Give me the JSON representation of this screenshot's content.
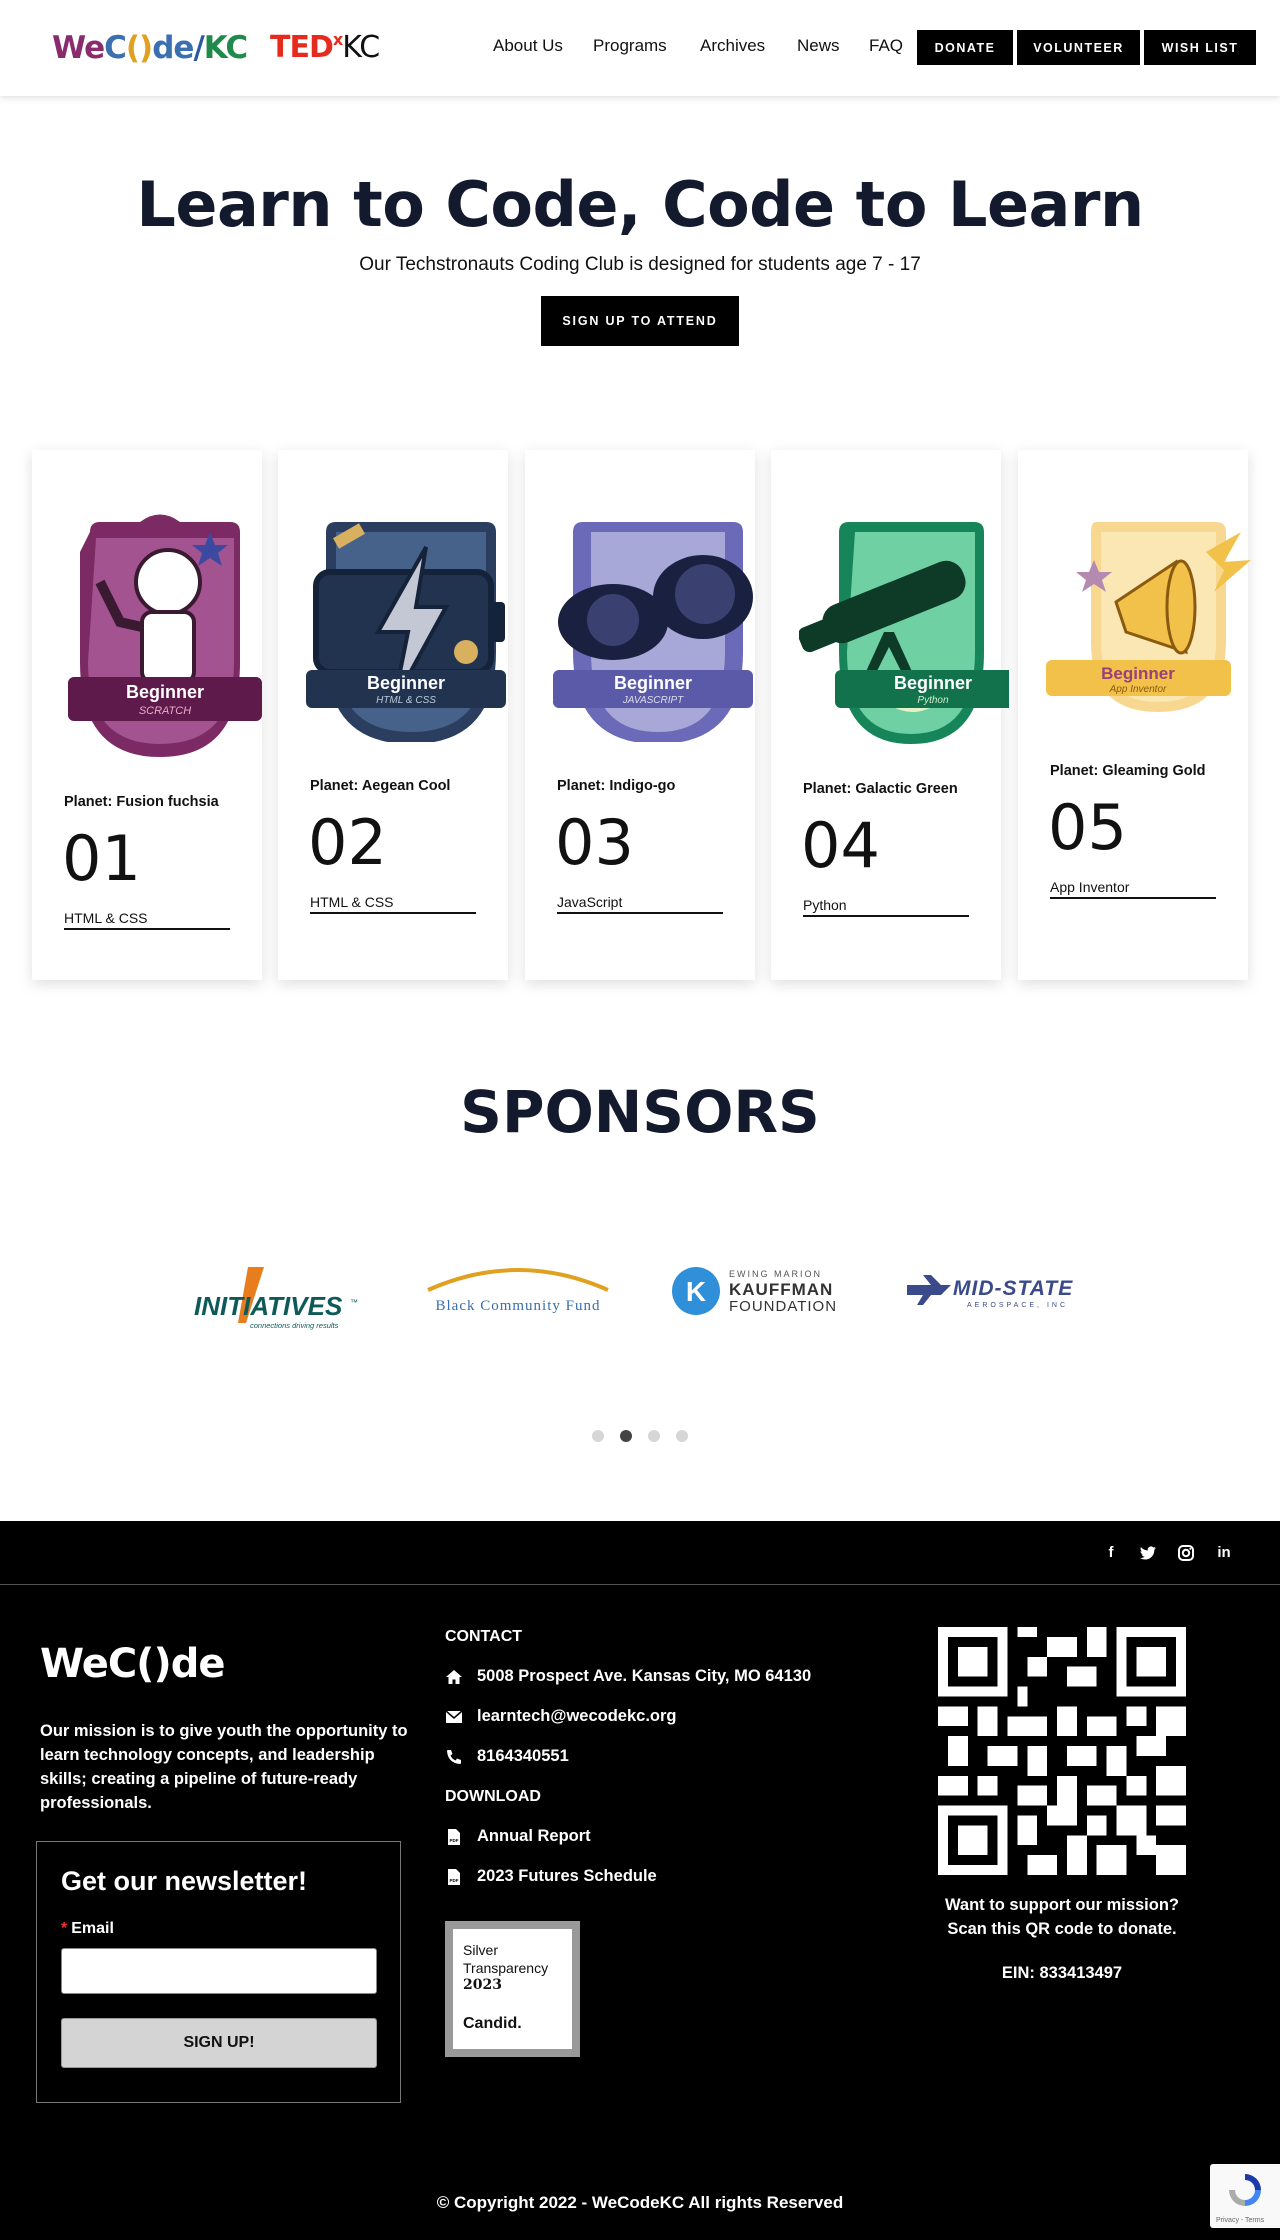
{
  "header": {
    "logo_parts": {
      "we": "We",
      "c": "C",
      "brackets": "()",
      "de": "de",
      "slash": "/",
      "kc": "KC"
    },
    "tedx": {
      "ted": "TED",
      "x": "x",
      "kc": "KC"
    },
    "nav": [
      "About Us",
      "Programs",
      "Archives",
      "News",
      "FAQ"
    ],
    "buttons": {
      "donate": "DONATE",
      "volunteer": "VOLUNTEER",
      "wishlist": "WISH LIST"
    }
  },
  "hero": {
    "title": "Learn to Code, Code to Learn",
    "subtitle": "Our Techstronauts Coding Club is designed for students age 7 - 17",
    "cta": "SIGN UP TO ATTEND"
  },
  "cards": [
    {
      "badge_title": "Beginner",
      "badge_sub": "SCRATCH",
      "planet": "Planet: Fusion fuchsia",
      "number": "01",
      "course": "HTML & CSS",
      "color": "#7c2a63",
      "accent": "#3b4aa0",
      "icon": "astronaut-icon"
    },
    {
      "badge_title": "Beginner",
      "badge_sub": "HTML & CSS",
      "planet": "Planet: Aegean Cool",
      "number": "02",
      "course": "HTML & CSS",
      "color": "#2c3e5f",
      "accent": "#d8b060",
      "icon": "lightning-battery-icon"
    },
    {
      "badge_title": "Beginner",
      "badge_sub": "JAVASCRIPT",
      "planet": "Planet: Indigo-go",
      "number": "03",
      "course": "JavaScript",
      "color": "#6a6ab8",
      "accent": "#1a2040",
      "icon": "goggles-icon"
    },
    {
      "badge_title": "Beginner",
      "badge_sub": "Python",
      "planet": "Planet: Galactic Green",
      "number": "04",
      "course": "Python",
      "color": "#16865a",
      "accent": "#0e3a28",
      "icon": "telescope-icon"
    },
    {
      "badge_title": "Beginner",
      "badge_sub": "App Inventor",
      "planet": "Planet: Gleaming Gold",
      "number": "05",
      "course": "App Inventor",
      "color": "#f2c14a",
      "accent": "#9b3f7a",
      "icon": "megaphone-icon"
    }
  ],
  "sponsors": {
    "title": "SPONSORS",
    "logos": [
      {
        "name": "INITIATIVES",
        "tm": "™",
        "tagline": "connections driving results"
      },
      {
        "name": "Black Community Fund"
      },
      {
        "name_small": "EWING MARION",
        "name_main": "KAUFFMAN",
        "name_sub": "FOUNDATION",
        "mark": "K"
      },
      {
        "name": "MID-STATE",
        "sub": "AEROSPACE, INC"
      }
    ],
    "dots": 4,
    "active_dot": 1
  },
  "footer": {
    "logo": "WeC()de",
    "mission": "Our mission is to give youth the opportunity to learn technology concepts, and leadership skills; creating a pipeline of future-ready professionals.",
    "newsletter": {
      "title": "Get our newsletter!",
      "required_mark": "*",
      "email_label": "Email",
      "button": "SIGN UP!"
    },
    "contact_heading": "CONTACT",
    "address": "5008 Prospect Ave. Kansas City, MO 64130",
    "email": "learntech@wecodekc.org",
    "phone": "8164340551",
    "download_heading": "DOWNLOAD",
    "downloads": [
      "Annual Report",
      "2023 Futures Schedule"
    ],
    "candid": {
      "line1": "Silver",
      "line2": "Transparency",
      "year": "2023",
      "brand": "Candid."
    },
    "qr_text_1": "Want to support our mission?",
    "qr_text_2": "Scan this QR code to donate.",
    "ein": "EIN: 833413497",
    "copyright": "© Copyright 2022 - WeCodeKC All rights Reserved",
    "recaptcha": "Privacy - Terms"
  }
}
